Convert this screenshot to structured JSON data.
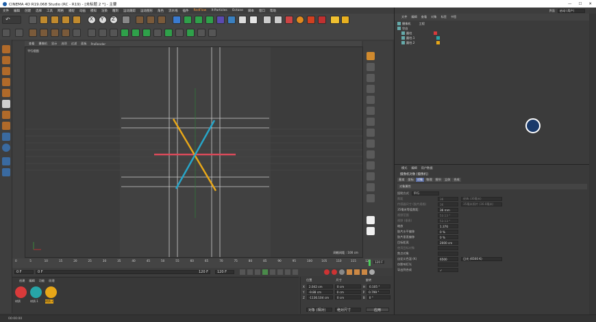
{
  "window": {
    "title": "CINEMA 4D R19.068 Studio (RC - R19) - [未标题 2 *] - 主要"
  },
  "menu": [
    "文件",
    "编辑",
    "创建",
    "选择",
    "工具",
    "网格",
    "捕捉",
    "动画",
    "模拟",
    "渲染",
    "雕刻",
    "运动跟踪",
    "运动图形",
    "角色",
    "流水线",
    "插件",
    "RedFlow",
    "X-Particles",
    "Octane",
    "脚本",
    "窗口",
    "帮助"
  ],
  "right_header": {
    "layout_label": "界面",
    "layout_value": "启动 (用户)"
  },
  "viewport": {
    "tabs": [
      "查看",
      "摄像机",
      "显示",
      "选项",
      "过滤",
      "面板",
      "ProRender"
    ],
    "camera_label": "平行视图",
    "grid_spacing": "网格间距 : 100 cm"
  },
  "timeline": {
    "ticks": [
      "0",
      "5",
      "10",
      "15",
      "20",
      "25",
      "30",
      "35",
      "40",
      "45",
      "50",
      "55",
      "60",
      "65",
      "70",
      "75",
      "80",
      "85",
      "90",
      "95",
      "100",
      "105",
      "110",
      "115",
      "120"
    ],
    "end_frame": "120 F"
  },
  "transport": {
    "current": "0 F",
    "start": "0 F",
    "end": "120 F",
    "range_end": "120 F"
  },
  "materials": {
    "tabs": [
      "创建",
      "编辑",
      "功能",
      "纹理"
    ],
    "items": [
      {
        "name": "材质",
        "color": "#d93a3a"
      },
      {
        "name": "材质.1",
        "color": "#27a5a8"
      },
      {
        "name": "材质.2",
        "color": "#e8a718"
      }
    ]
  },
  "coords": {
    "headers": [
      "位置",
      "尺寸",
      "旋转"
    ],
    "rows": [
      {
        "axis": "X",
        "pos": "2.042 cm",
        "size": "0 cm",
        "rot_label": "H",
        "rot": "0.105 °"
      },
      {
        "axis": "Y",
        "pos": "-9.88 cm",
        "size": "0 cm",
        "rot_label": "P",
        "rot": "0.799 °"
      },
      {
        "axis": "Z",
        "pos": "-1136.104 cm",
        "size": "0 cm",
        "rot_label": "B",
        "rot": "0 °"
      }
    ],
    "mode": "对象 (相对)",
    "size_mode": "绝对尺寸",
    "apply": "应用"
  },
  "objects": {
    "tabs": [
      "文件",
      "编辑",
      "查看",
      "对象",
      "标签",
      "书签"
    ],
    "items": [
      {
        "name": "摄像机",
        "tag": "工程"
      },
      {
        "name": "空白"
      },
      {
        "name": "圆柱",
        "color": "#d93a3a"
      },
      {
        "name": "圆柱.1",
        "color": "#27a5a8"
      },
      {
        "name": "圆柱.2",
        "color": "#e8a718"
      }
    ]
  },
  "attributes": {
    "tabs": [
      "模式",
      "编辑",
      "用户数据"
    ],
    "title": "摄像机对象 [摄像机]",
    "subtabs": [
      "基本",
      "坐标",
      "对象",
      "物理",
      "细节",
      "立体",
      "合成"
    ],
    "section": "对象属性",
    "projection_label": "投射方式",
    "projection_value": "平行",
    "rows": [
      {
        "label": "焦距",
        "value": "36",
        "extra": "经典 (36毫米)",
        "dim": true
      },
      {
        "label": "传感器尺寸 (胶片规格)",
        "value": "36",
        "extra": "35毫米照片 (36.0毫米)",
        "dim": true
      },
      {
        "label": "35毫米等值焦距:",
        "value": "36 mm",
        "dim": false
      },
      {
        "label": "视野范围",
        "value": "53.13 °",
        "dim": true
      },
      {
        "label": "视野 (垂直)",
        "value": "53.13 °",
        "dim": true
      },
      {
        "label": "缩放",
        "value": "1.376",
        "dim": false
      },
      {
        "label": "胶片水平偏移",
        "value": "0 %",
        "dim": false
      },
      {
        "label": "胶片垂直偏移",
        "value": "0 %",
        "dim": false
      },
      {
        "label": "目标距离",
        "value": "2000 cm",
        "dim": false
      },
      {
        "label": "使用目标对象",
        "value": "",
        "dim": true
      },
      {
        "label": "焦点对象",
        "value": "",
        "dim": false
      },
      {
        "label": "自定义色温 (K)",
        "value": "6500",
        "extra": "日光 (6500 K)",
        "dim": false
      },
      {
        "label": "仅影响灯光",
        "value": "",
        "dim": false
      },
      {
        "label": "导出到合成",
        "value": "✓",
        "dim": false
      }
    ]
  },
  "status": {
    "time": "00:00:00"
  },
  "colors": {
    "red": "#d93a3a",
    "cyan": "#27a5a8",
    "orange": "#e8a718",
    "accent": "#5b6ea5"
  }
}
